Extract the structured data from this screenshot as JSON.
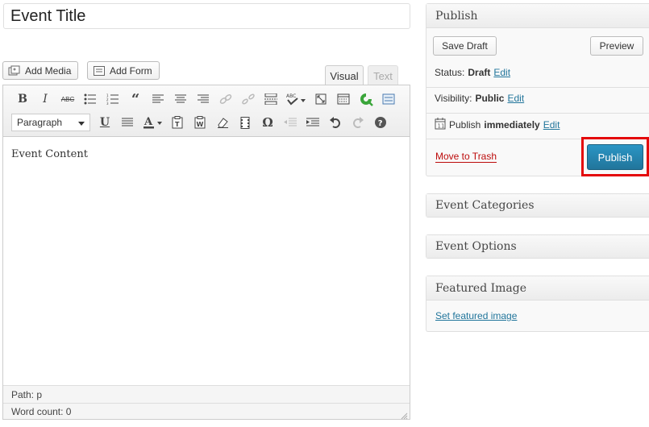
{
  "title": {
    "value": "Event Title"
  },
  "media": {
    "add_media": "Add Media",
    "add_form": "Add Form"
  },
  "editor": {
    "tab_visual": "Visual",
    "tab_text": "Text",
    "format_select": "Paragraph",
    "content": "Event Content",
    "path": "Path: p",
    "word_count": "Word count: 0"
  },
  "publish": {
    "title": "Publish",
    "save_draft": "Save Draft",
    "preview": "Preview",
    "status_label": "Status:",
    "status_value": "Draft",
    "visibility_label": "Visibility:",
    "visibility_value": "Public",
    "publish_label": "Publish",
    "publish_value": "immediately",
    "edit": "Edit",
    "move_to_trash": "Move to Trash",
    "publish_button": "Publish"
  },
  "categories": {
    "title": "Event Categories"
  },
  "options": {
    "title": "Event Options"
  },
  "featured": {
    "title": "Featured Image",
    "link": "Set featured image"
  },
  "colors": {
    "accent": "#21759b",
    "highlight": "#e4080a",
    "trash": "#bc0b0b"
  }
}
